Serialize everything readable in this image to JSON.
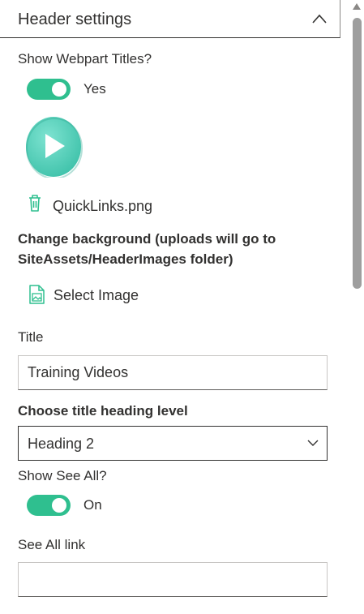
{
  "section": {
    "title": "Header settings",
    "expanded": true
  },
  "show_webpart_titles": {
    "label": "Show Webpart Titles?",
    "state_text": "Yes",
    "enabled": true
  },
  "image": {
    "thumbnail_icon": "play-icon",
    "file_name": "QuickLinks.png",
    "delete_icon": "trash-icon"
  },
  "background": {
    "label": "Change background (uploads will go to SiteAssets/HeaderImages folder)",
    "label_line1": "Change background (uploads will go to",
    "label_line2": "SiteAssets/HeaderImages folder)",
    "select_label": "Select Image",
    "select_icon": "image-icon"
  },
  "title_field": {
    "label": "Title",
    "value": "Training Videos"
  },
  "heading_level": {
    "label": "Choose title heading level",
    "selected": "Heading 2"
  },
  "show_see_all": {
    "label": "Show See All?",
    "state_text": "On",
    "enabled": true
  },
  "see_all_link": {
    "label": "See All link",
    "value": ""
  },
  "colors": {
    "accent": "#2fbf8f",
    "text": "#323130",
    "thumbnail": "#5cd6c0"
  }
}
